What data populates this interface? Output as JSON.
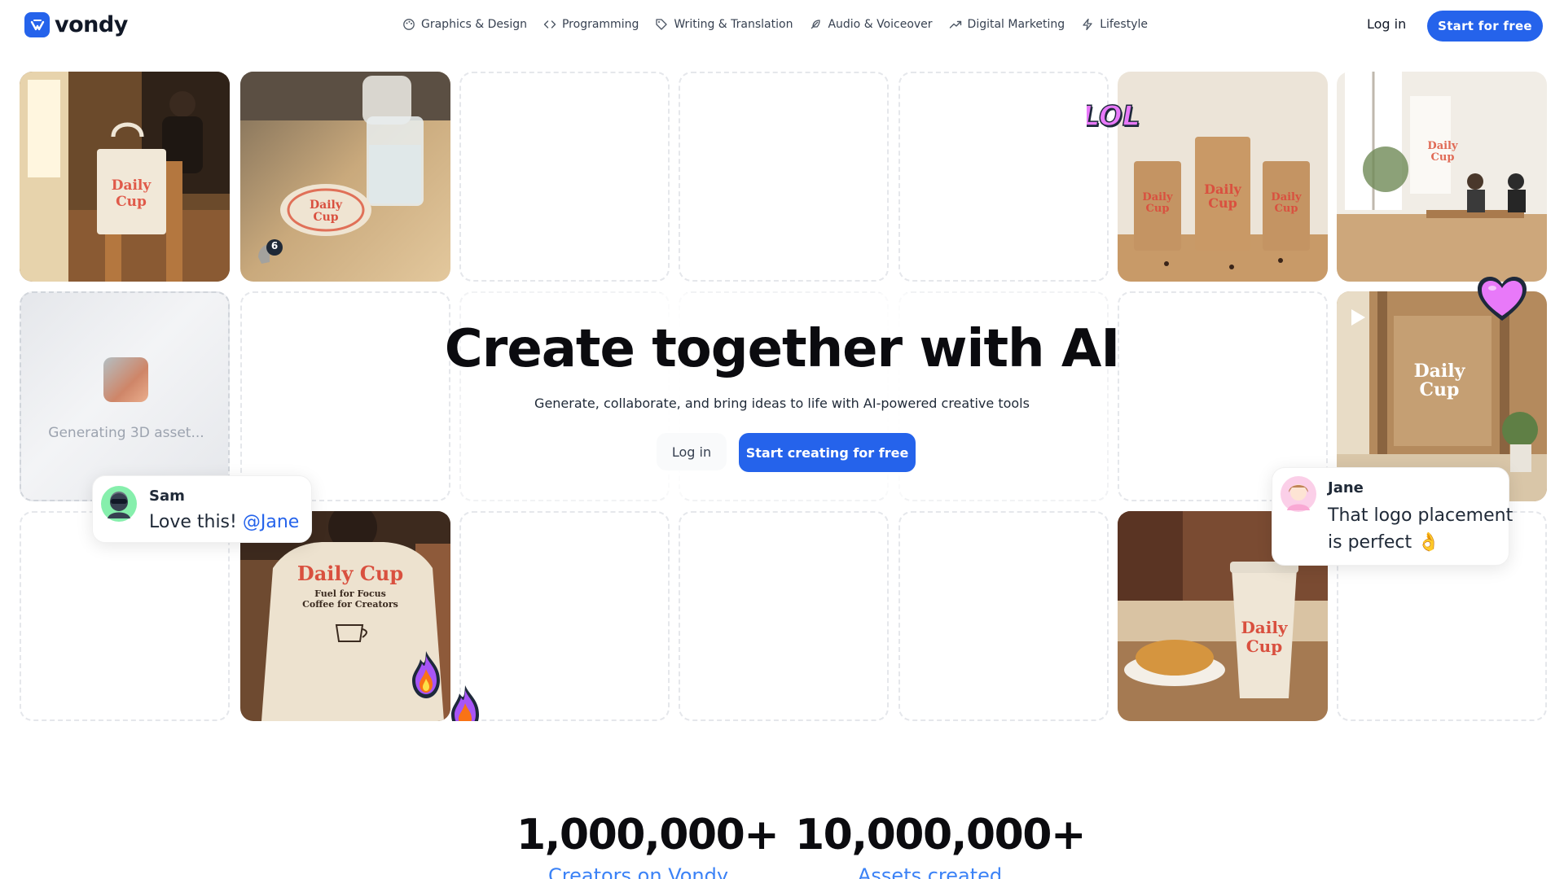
{
  "brand": {
    "name": "vondy",
    "color": "#2563eb"
  },
  "nav": {
    "links": [
      {
        "label": "Graphics & Design",
        "icon": "palette-icon"
      },
      {
        "label": "Programming",
        "icon": "code-icon"
      },
      {
        "label": "Writing & Translation",
        "icon": "tag-pen-icon"
      },
      {
        "label": "Audio & Voiceover",
        "icon": "feather-icon"
      },
      {
        "label": "Digital Marketing",
        "icon": "trend-up-icon"
      },
      {
        "label": "Lifestyle",
        "icon": "lightning-icon"
      }
    ],
    "login": "Log in",
    "cta": "Start for free"
  },
  "hero": {
    "title": "Create together with AI",
    "subtitle": "Generate, collaborate, and bring ideas to life with AI-powered creative tools",
    "login": "Log in",
    "cta": "Start creating for free"
  },
  "grid": {
    "generating_label": "Generating 3D asset...",
    "comment_count": "6",
    "stickers": [
      "LOL",
      "heart",
      "fire",
      "fire"
    ],
    "mockup_text": {
      "tote": "Daily Cup",
      "coaster": "Daily Cup",
      "bags": "Daily Cup",
      "window": "Daily Cup",
      "video": "Daily Cup",
      "tshirt_title": "Daily Cup",
      "tshirt_line1": "Fuel for Focus",
      "tshirt_line2": "Coffee for Creators",
      "cup": "Daily Cup"
    }
  },
  "comments": [
    {
      "name": "Sam",
      "text": "Love this!",
      "mention": "@Jane"
    },
    {
      "name": "Jane",
      "text_line1": "That logo placement",
      "text_line2": "is perfect 👌"
    }
  ],
  "stats": [
    {
      "value": "1,000,000+",
      "label": "Creators on Vondy"
    },
    {
      "value": "10,000,000+",
      "label": "Assets created"
    }
  ],
  "colors": {
    "accent": "#2563eb",
    "mention": "#2563eb",
    "stat_label": "#3b82f6",
    "sticker_pink": "#e879f9"
  }
}
